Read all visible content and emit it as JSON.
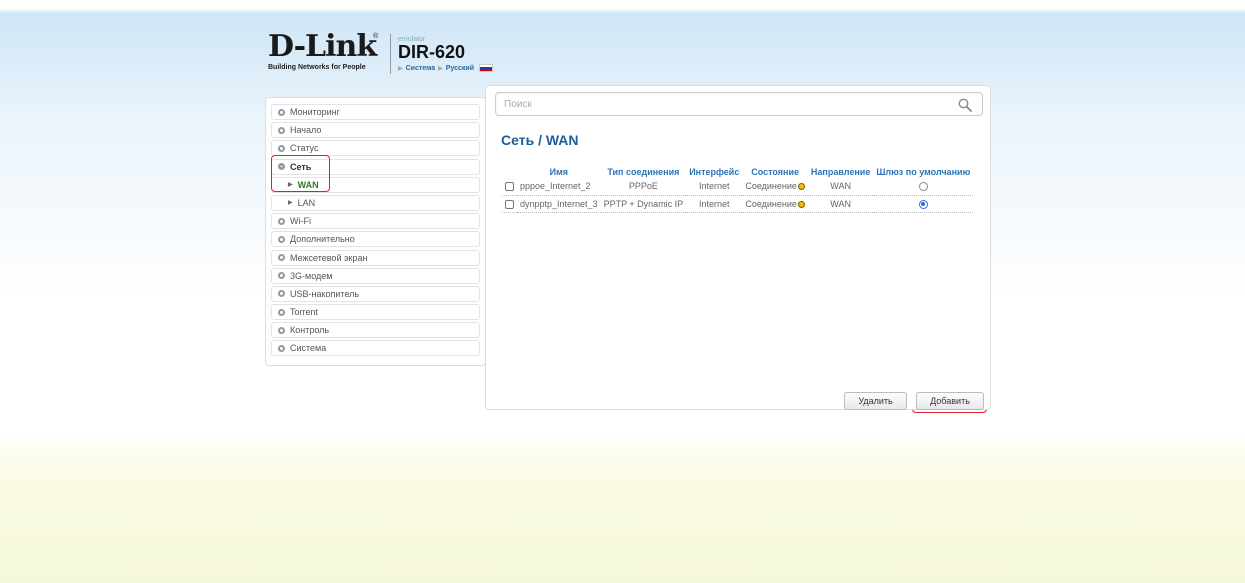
{
  "header": {
    "logo": "D-Link",
    "logo_reg": "®",
    "tagline": "Building Networks for People",
    "emulator_label": "emulator",
    "model": "DIR-620",
    "breadcrumb": [
      "Система",
      "Русский"
    ]
  },
  "sidebar": {
    "items": [
      {
        "label": "Мониторинг"
      },
      {
        "label": "Начало"
      },
      {
        "label": "Статус"
      },
      {
        "label": "Сеть"
      },
      {
        "label": "WAN"
      },
      {
        "label": "LAN"
      },
      {
        "label": "Wi-Fi"
      },
      {
        "label": "Дополнительно"
      },
      {
        "label": "Межсетевой экран"
      },
      {
        "label": "3G-модем"
      },
      {
        "label": "USB-накопитель"
      },
      {
        "label": "Torrent"
      },
      {
        "label": "Контроль"
      },
      {
        "label": "Система"
      }
    ]
  },
  "search": {
    "placeholder": "Поиск"
  },
  "page_title": "Сеть /  WAN",
  "table": {
    "headers": [
      "Имя",
      "Тип соединения",
      "Интерфейс",
      "Состояние",
      "Направление",
      "Шлюз по умолчанию"
    ],
    "rows": [
      {
        "name": "pppoe_Internet_2",
        "type": "PPPoE",
        "interface": "Internet",
        "status": "Соединение",
        "direction": "WAN",
        "default_gw": false
      },
      {
        "name": "dynpptp_Internet_3",
        "type": "PPTP + Dynamic IP",
        "interface": "Internet",
        "status": "Соединение",
        "direction": "WAN",
        "default_gw": true
      }
    ]
  },
  "buttons": {
    "delete": "Удалить",
    "add": "Добавить"
  },
  "colors": {
    "accent": "#2b73b8",
    "highlight": "#d9232b",
    "status_dot": "#f0c000"
  }
}
